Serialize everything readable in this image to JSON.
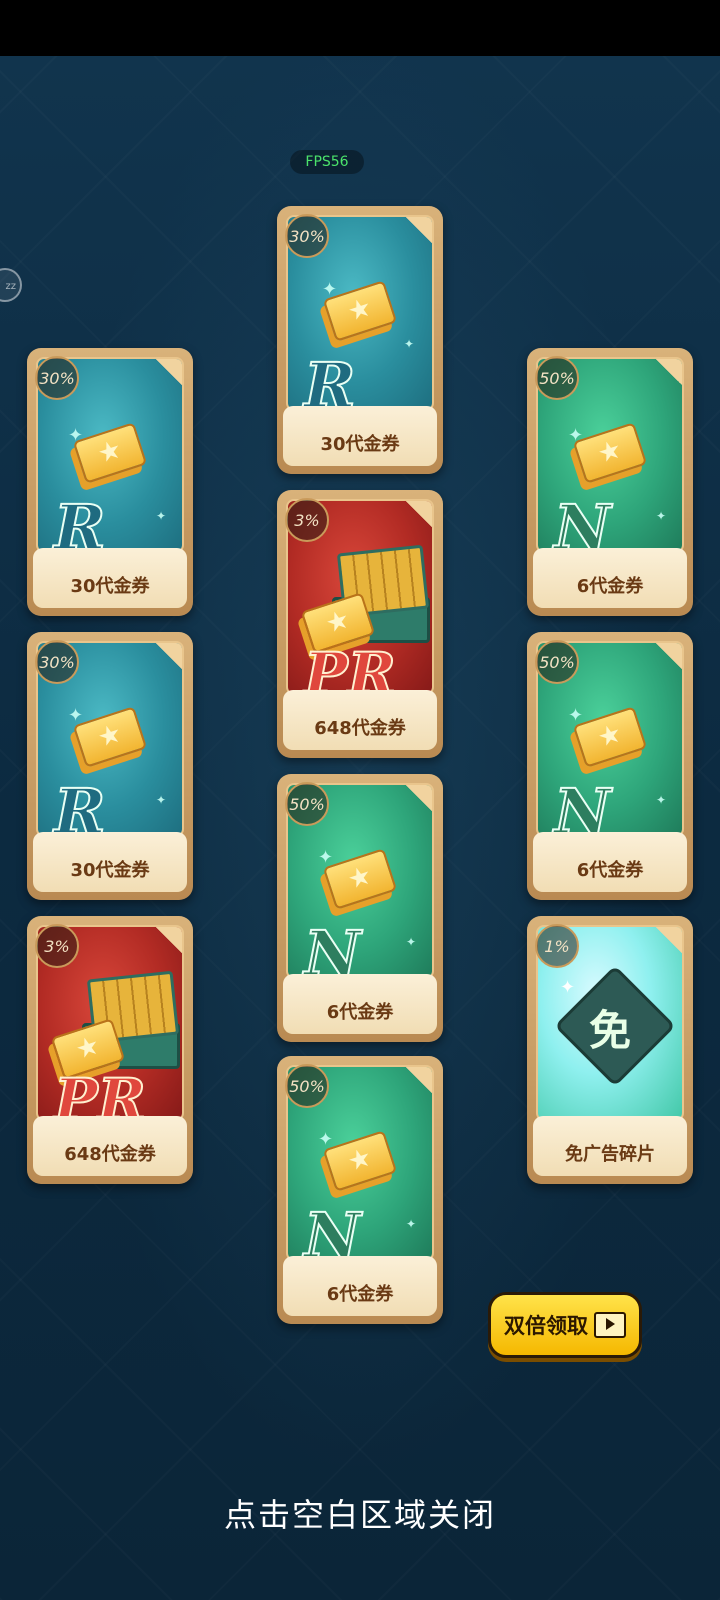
{
  "status_bar": {
    "fps": "FPS56"
  },
  "side_bubble": {
    "label": "zz"
  },
  "cards": [
    {
      "pct": "30%",
      "rarity": "R",
      "label": "30代金券",
      "theme": "teal",
      "item": "ticket"
    },
    {
      "pct": "30%",
      "rarity": "R",
      "label": "30代金券",
      "theme": "teal",
      "item": "ticket"
    },
    {
      "pct": "30%",
      "rarity": "R",
      "label": "30代金券",
      "theme": "teal",
      "item": "ticket"
    },
    {
      "pct": "3%",
      "rarity": "PR",
      "label": "648代金券",
      "theme": "red",
      "item": "chest"
    },
    {
      "pct": "3%",
      "rarity": "PR",
      "label": "648代金券",
      "theme": "red",
      "item": "chest"
    },
    {
      "pct": "50%",
      "rarity": "N",
      "label": "6代金券",
      "theme": "green",
      "item": "ticket"
    },
    {
      "pct": "50%",
      "rarity": "N",
      "label": "6代金券",
      "theme": "green",
      "item": "ticket"
    },
    {
      "pct": "50%",
      "rarity": "N",
      "label": "6代金券",
      "theme": "green",
      "item": "ticket"
    },
    {
      "pct": "50%",
      "rarity": "N",
      "label": "6代金券",
      "theme": "green",
      "item": "ticket"
    },
    {
      "pct": "1%",
      "rarity": "",
      "label": "免广告碎片",
      "theme": "cyan",
      "item": "puzzle",
      "item_char": "免"
    }
  ],
  "double_button": {
    "label": "双倍领取",
    "icon": "video-icon"
  },
  "close_hint": "点击空白区域关闭",
  "colors": {
    "background": "#0d2a3f",
    "button": "#f5b800",
    "fps_text": "#4be36b"
  }
}
